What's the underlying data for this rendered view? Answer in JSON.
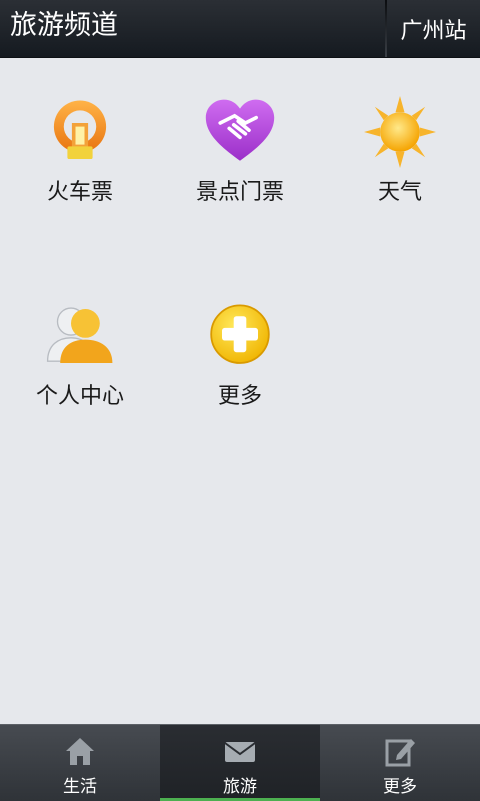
{
  "header": {
    "title": "旅游频道",
    "city_button": "广州站"
  },
  "grid": {
    "items": [
      {
        "label": "火车票",
        "icon": "train-logo-icon"
      },
      {
        "label": "景点门票",
        "icon": "handshake-heart-icon"
      },
      {
        "label": "天气",
        "icon": "sun-icon"
      },
      {
        "label": "个人中心",
        "icon": "user-profile-icon"
      },
      {
        "label": "更多",
        "icon": "plus-circle-icon"
      }
    ]
  },
  "tabbar": {
    "tabs": [
      {
        "label": "生活",
        "icon": "home-icon",
        "active": false
      },
      {
        "label": "旅游",
        "icon": "envelope-icon",
        "active": true
      },
      {
        "label": "更多",
        "icon": "edit-icon",
        "active": false
      }
    ],
    "accent_color": "#4caf50"
  }
}
